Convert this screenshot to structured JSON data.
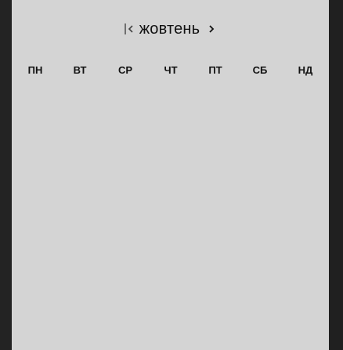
{
  "calendar": {
    "month": "жовтень",
    "prev_icon": "first-page-chevron-icon",
    "next_icon": "chevron-right-icon",
    "weekdays": [
      "ПН",
      "ВТ",
      "СР",
      "ЧТ",
      "ПТ",
      "СБ",
      "НД"
    ]
  },
  "colors": {
    "calendar_background": "#d4d4d4",
    "text": "#111111",
    "side_panels": "#1e1e1e"
  }
}
